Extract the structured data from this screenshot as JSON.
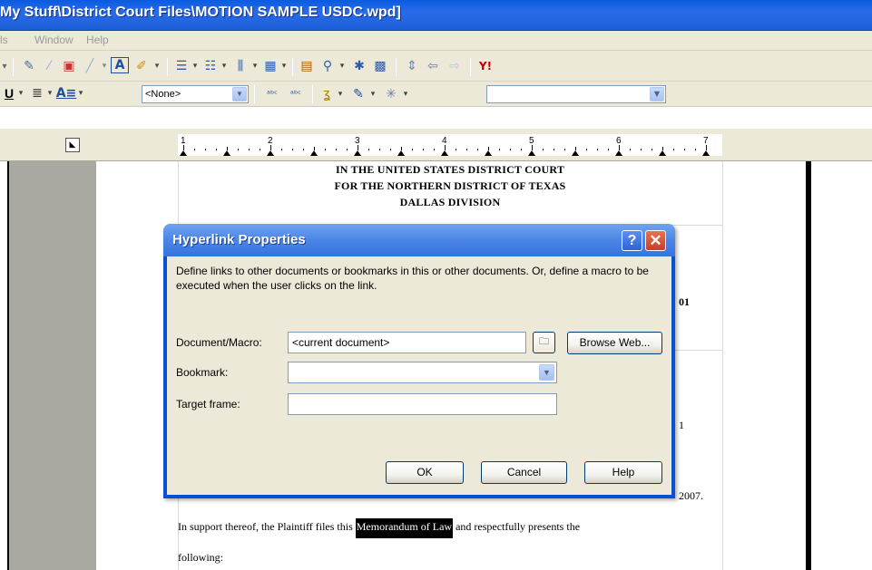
{
  "window": {
    "title": "My Stuff\\District Court Files\\MOTION SAMPLE USDC.wpd]"
  },
  "menubar": {
    "items": [
      "ls",
      "Window",
      "Help"
    ]
  },
  "toolbar2": {
    "style_value": "<None>"
  },
  "ruler": {
    "numbers": [
      "1",
      "2",
      "3",
      "4",
      "5",
      "6",
      "7"
    ]
  },
  "document": {
    "court_line1": "IN THE UNITED STATES DISTRICT COURT",
    "court_line2": "FOR THE NORTHERN DISTRICT OF TEXAS",
    "court_line3": "DALLAS DIVISION",
    "fragment_01": "01",
    "fragment_1": "1",
    "fragment_2007": "2007.",
    "para_before": "In support thereof, the Plaintiff files this",
    "para_highlight": "Memorandum of Law",
    "para_after": "and respectfully presents the",
    "para_line2": "following:"
  },
  "dialog": {
    "title": "Hyperlink Properties",
    "help_glyph": "?",
    "close_glyph": "✕",
    "description": "Define links to other documents or bookmarks in this or other documents. Or, define a macro to be executed when the user clicks on the link.",
    "document_label": "Document/Macro:",
    "document_value": "<current document>",
    "browse_web_label": "Browse Web...",
    "bookmark_label": "Bookmark:",
    "bookmark_value": "",
    "target_label": "Target frame:",
    "target_value": "",
    "ok_label": "OK",
    "cancel_label": "Cancel",
    "help_label": "Help"
  },
  "colors": {
    "xp_titlebar": "#0a5be0",
    "dialog_frame": "#0a4fd0",
    "face": "#ece9d8",
    "close_red": "#c4402a"
  }
}
